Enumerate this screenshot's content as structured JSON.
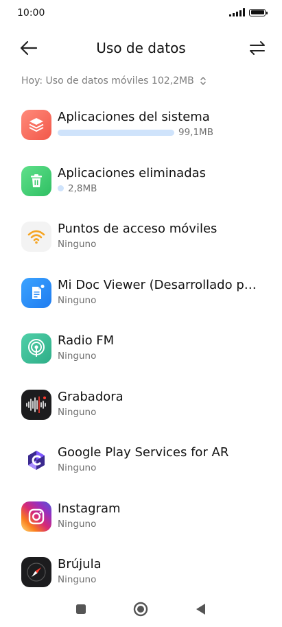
{
  "status": {
    "time": "10:00"
  },
  "header": {
    "title": "Uso de datos"
  },
  "summary": {
    "text": "Hoy: Uso de datos móviles 102,2MB"
  },
  "apps": [
    {
      "name": "Aplicaciones del sistema",
      "detail": "99,1MB",
      "usage_fraction": 0.97,
      "icon": "layers-icon"
    },
    {
      "name": "Aplicaciones eliminadas",
      "detail": "2,8MB",
      "usage_fraction": 0.03,
      "icon": "trash-icon"
    },
    {
      "name": "Puntos de acceso móviles",
      "detail": "Ninguno",
      "icon": "wifi-hotspot-icon"
    },
    {
      "name": "Mi Doc Viewer (Desarrollado por…",
      "detail": "Ninguno",
      "icon": "document-icon"
    },
    {
      "name": "Radio FM",
      "detail": "Ninguno",
      "icon": "radio-antenna-icon"
    },
    {
      "name": "Grabadora",
      "detail": "Ninguno",
      "icon": "sound-wave-icon"
    },
    {
      "name": "Google Play Services for AR",
      "detail": "Ninguno",
      "icon": "ar-core-icon"
    },
    {
      "name": "Instagram",
      "detail": "Ninguno",
      "icon": "instagram-icon"
    },
    {
      "name": "Brújula",
      "detail": "Ninguno",
      "icon": "compass-icon"
    }
  ],
  "colors": {
    "usage_bar": "#cfe3fb",
    "secondary_text": "#6f6f6f",
    "summary_text": "#7d7d7d"
  }
}
